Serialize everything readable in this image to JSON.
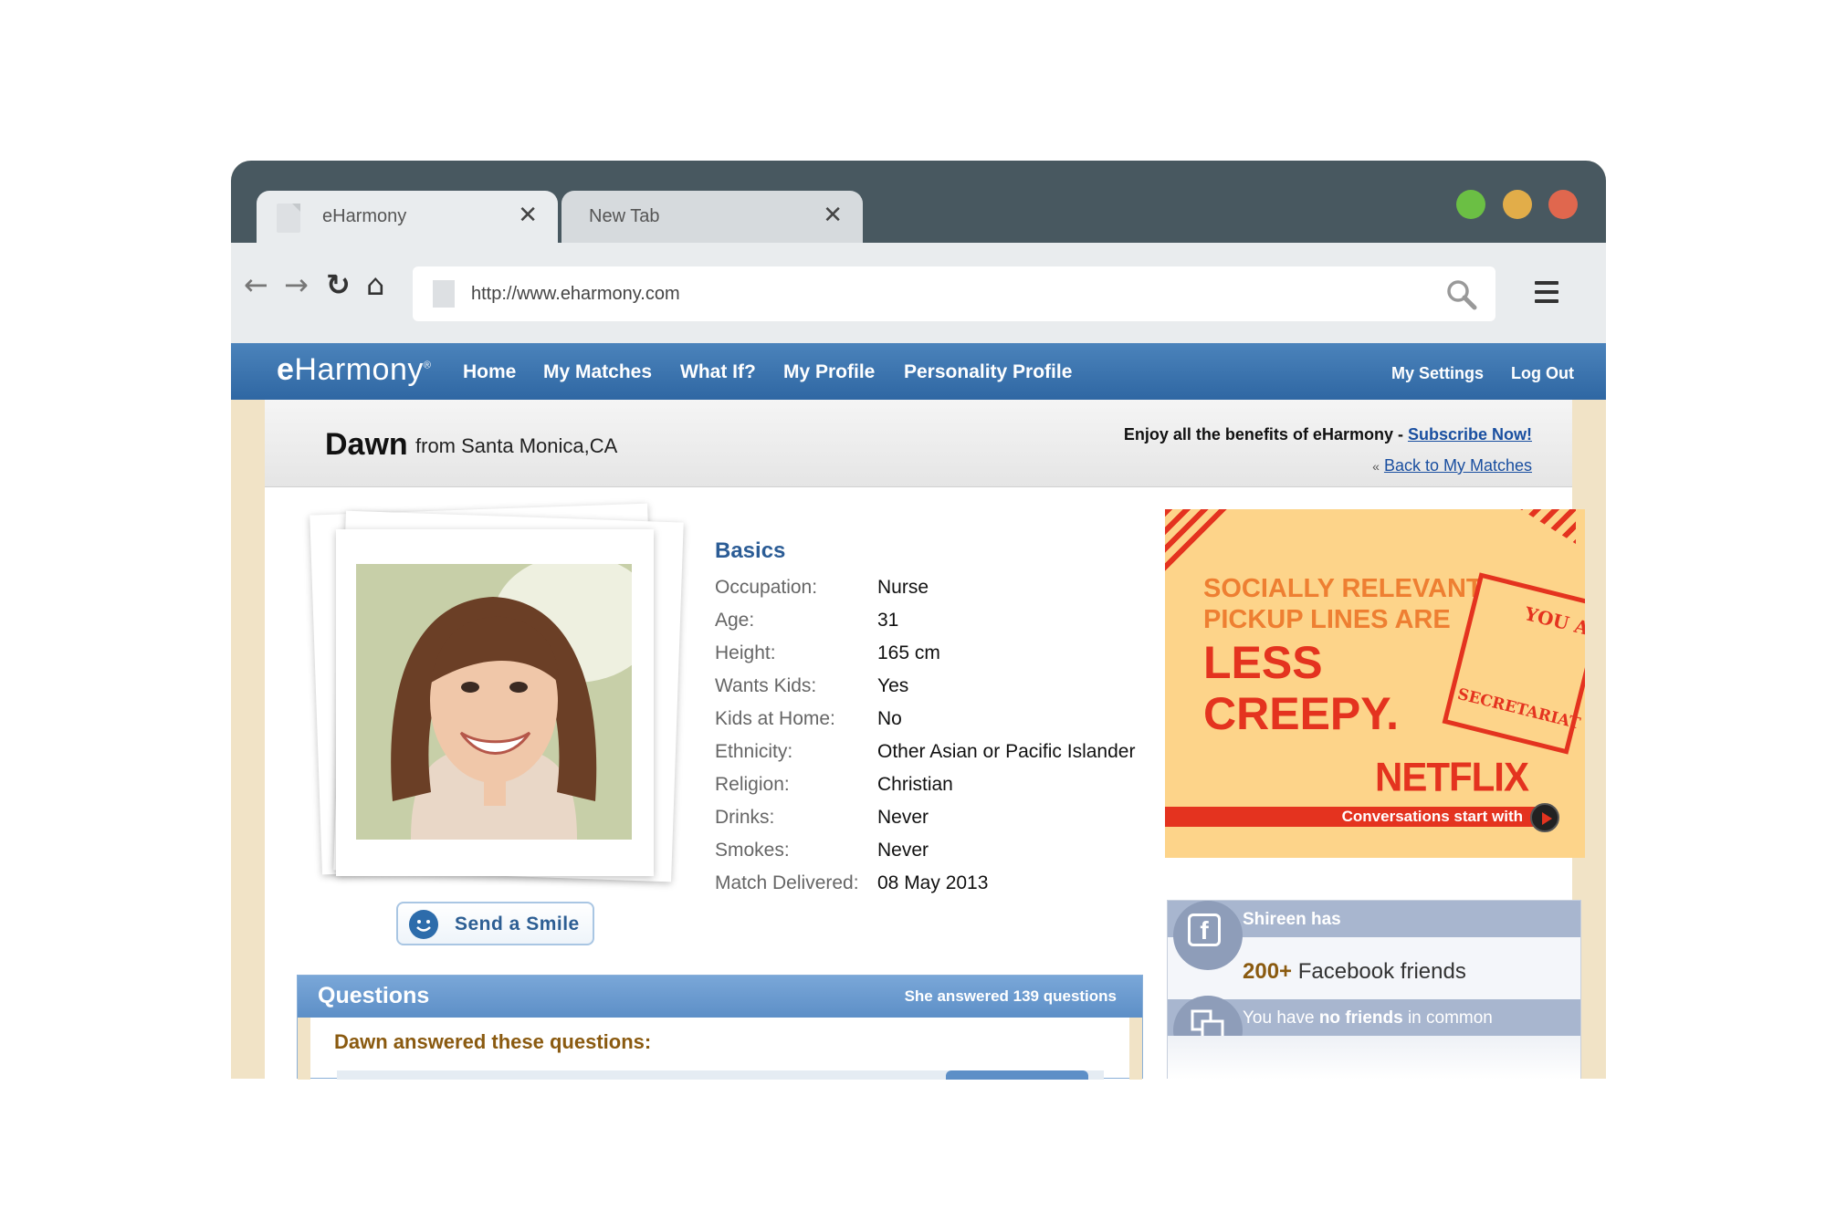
{
  "browser": {
    "tabs": [
      {
        "label": "eHarmony",
        "close": "✕"
      },
      {
        "label": "New Tab",
        "close": "✕"
      }
    ],
    "nav": {
      "back": "←",
      "forward": "→",
      "reload": "↻",
      "home": "⌂"
    },
    "url": "http://www.eharmony.com",
    "window_controls": {
      "green": "#6bbf44",
      "yellow": "#e2ad49",
      "red": "#e0674e"
    }
  },
  "site": {
    "logo": {
      "e": "e",
      "rest": "Harmony",
      "mark": "®"
    },
    "nav": [
      "Home",
      "My Matches",
      "What If?",
      "My Profile",
      "Personality Profile"
    ],
    "nav_right": [
      "My Settings",
      "Log Out"
    ],
    "brand_color": "#3a73b0"
  },
  "profile": {
    "name": "Dawn",
    "location": "from Santa Monica,CA",
    "promo_text": "Enjoy all the benefits of eHarmony - ",
    "promo_link": "Subscribe Now!",
    "back_prefix": "«",
    "back_link": "Back to My Matches",
    "send_smile": "Send a Smile"
  },
  "basics": {
    "title": "Basics",
    "rows": [
      {
        "k": "Occupation:",
        "v": "Nurse"
      },
      {
        "k": "Age:",
        "v": "31"
      },
      {
        "k": "Height:",
        "v": "165 cm"
      },
      {
        "k": "Wants Kids:",
        "v": "Yes"
      },
      {
        "k": "Kids at Home:",
        "v": "No"
      },
      {
        "k": "Ethnicity:",
        "v": "Other Asian or Pacific Islander"
      },
      {
        "k": "Religion:",
        "v": "Christian"
      },
      {
        "k": "Drinks:",
        "v": "Never"
      },
      {
        "k": "Smokes:",
        "v": "Never"
      },
      {
        "k": "Match Delivered:",
        "v": "08 May 2013"
      }
    ]
  },
  "questions": {
    "title": "Questions",
    "count": "She answered 139 questions",
    "subtitle": "Dawn answered these questions:"
  },
  "ad": {
    "line1": "SOCIALLY RELEVANT",
    "line2": "PICKUP LINES ARE",
    "line3": "LESS",
    "line4": "CREEPY.",
    "stamp_top": "YOU ARE",
    "stamp_bottom": "SECRETARIAT",
    "brand": "NETFLIX",
    "tagline": "Conversations start with"
  },
  "facebook": {
    "icon": "f",
    "friend_line": "Shireen has",
    "count": "200+",
    "count_suffix": " Facebook friends",
    "common_prefix": "You have ",
    "common_bold": "no friends",
    "common_suffix": " in common"
  }
}
